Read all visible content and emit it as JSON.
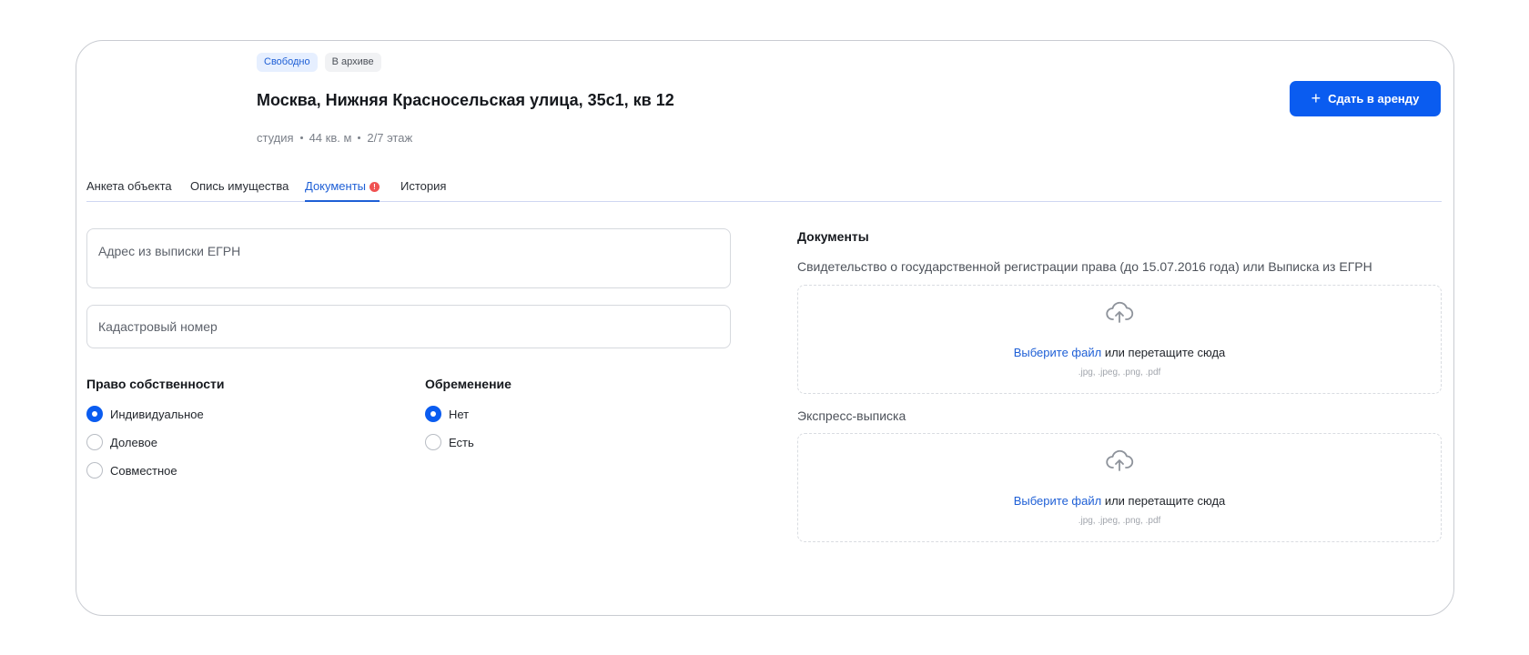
{
  "badges": {
    "free": "Свободно",
    "archive": "В архиве"
  },
  "object": {
    "title": "Москва, Нижняя Красносельская улица, 35с1, кв 12",
    "type": "студия",
    "area": "44 кв. м",
    "floor": "2/7 этаж"
  },
  "actions": {
    "rent_label": "Сдать в аренду",
    "rent_icon": "plus-icon"
  },
  "tabs": [
    {
      "label": "Анкета объекта"
    },
    {
      "label": "Опись имущества"
    },
    {
      "label": "Документы",
      "active": true,
      "alert": "!"
    },
    {
      "label": "История"
    }
  ],
  "fields": {
    "egrn_address_placeholder": "Адрес из выписки ЕГРН",
    "cadastral_placeholder": "Кадастровый номер"
  },
  "ownership": {
    "title": "Право собственности",
    "options": [
      "Индивидуальное",
      "Долевое",
      "Совместное"
    ],
    "selected": "Индивидуальное"
  },
  "encumbrance": {
    "title": "Обременение",
    "options": [
      "Нет",
      "Есть"
    ],
    "selected": "Нет"
  },
  "documents": {
    "title": "Документы",
    "items": [
      {
        "label": "Свидетельство о государственной регистрации права (до 15.07.2016 года) или Выписка из ЕГРН",
        "choose_link": "Выберите файл",
        "drop_text": "или перетащите сюда",
        "types": ".jpg, .jpeg, .png, .pdf"
      },
      {
        "label": "Экспресс-выписка",
        "choose_link": "Выберите файл",
        "drop_text": "или перетащите сюда",
        "types": ".jpg, .jpeg, .png, .pdf"
      }
    ]
  },
  "colors": {
    "accent": "#0a5cf0",
    "link": "#1e5fd6",
    "alert": "#f05252",
    "free_badge_bg": "#e6efff"
  },
  "icons": {
    "upload": "cloud-upload-icon"
  }
}
